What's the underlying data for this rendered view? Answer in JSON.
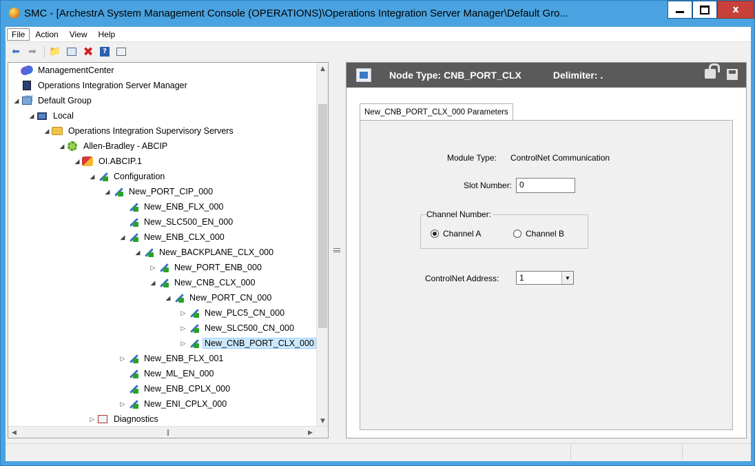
{
  "window": {
    "title": "SMC - [ArchestrA System Management Console (OPERATIONS)\\Operations Integration Server Manager\\Default Gro..."
  },
  "menubar": {
    "items": [
      "File",
      "Action",
      "View",
      "Help"
    ]
  },
  "toolbar": {
    "buttons": [
      "back-arrow-icon",
      "forward-arrow-icon",
      "up-folder-icon",
      "show-hide-tree-icon",
      "delete-icon",
      "help-icon",
      "properties-icon"
    ]
  },
  "tree": {
    "items": [
      {
        "label": "ManagementCenter",
        "icon": "management-icon",
        "level": 0,
        "expander": ""
      },
      {
        "label": "Operations Integration Server Manager",
        "icon": "server-icon",
        "level": 0,
        "expander": ""
      },
      {
        "label": "Default Group",
        "icon": "group-icon",
        "level": 0,
        "expander": "expanded"
      },
      {
        "label": "Local",
        "icon": "computer-icon",
        "level": 1,
        "expander": "expanded"
      },
      {
        "label": "Operations Integration Supervisory Servers",
        "icon": "folder-icon",
        "level": 2,
        "expander": "expanded"
      },
      {
        "label": "Allen-Bradley - ABCIP",
        "icon": "gear-icon",
        "level": 3,
        "expander": "expanded"
      },
      {
        "label": "OI.ABCIP.1",
        "icon": "oi-server-icon",
        "level": 4,
        "expander": "expanded"
      },
      {
        "label": "Configuration",
        "icon": "configuration-icon",
        "level": 5,
        "expander": "expanded"
      },
      {
        "label": "New_PORT_CIP_000",
        "icon": "port-icon",
        "level": 6,
        "expander": "expanded"
      },
      {
        "label": "New_ENB_FLX_000",
        "icon": "port-icon",
        "level": 7,
        "expander": ""
      },
      {
        "label": "New_SLC500_EN_000",
        "icon": "port-icon",
        "level": 7,
        "expander": ""
      },
      {
        "label": "New_ENB_CLX_000",
        "icon": "port-icon",
        "level": 7,
        "expander": "expanded"
      },
      {
        "label": "New_BACKPLANE_CLX_000",
        "icon": "port-icon",
        "level": 8,
        "expander": "expanded"
      },
      {
        "label": "New_PORT_ENB_000",
        "icon": "port-icon",
        "level": 9,
        "expander": "collapsed"
      },
      {
        "label": "New_CNB_CLX_000",
        "icon": "port-icon",
        "level": 9,
        "expander": "expanded"
      },
      {
        "label": "New_PORT_CN_000",
        "icon": "port-icon",
        "level": 10,
        "expander": "expanded"
      },
      {
        "label": "New_PLC5_CN_000",
        "icon": "port-icon",
        "level": 11,
        "expander": "collapsed"
      },
      {
        "label": "New_SLC500_CN_000",
        "icon": "port-icon",
        "level": 11,
        "expander": "collapsed"
      },
      {
        "label": "New_CNB_PORT_CLX_000",
        "icon": "port-icon",
        "level": 11,
        "expander": "collapsed",
        "selected": true
      },
      {
        "label": "New_ENB_FLX_001",
        "icon": "port-icon",
        "level": 7,
        "expander": "collapsed"
      },
      {
        "label": "New_ML_EN_000",
        "icon": "port-icon",
        "level": 7,
        "expander": ""
      },
      {
        "label": "New_ENB_CPLX_000",
        "icon": "port-icon",
        "level": 7,
        "expander": ""
      },
      {
        "label": "New_ENI_CPLX_000",
        "icon": "port-icon",
        "level": 7,
        "expander": "collapsed"
      },
      {
        "label": "Diagnostics",
        "icon": "diagnostics-icon",
        "level": 5,
        "expander": "collapsed"
      }
    ]
  },
  "node_header": {
    "node_type": "Node Type: CNB_PORT_CLX",
    "delimiter": "Delimiter: ."
  },
  "tab": {
    "label": "New_CNB_PORT_CLX_000 Parameters"
  },
  "form": {
    "module_type_label": "Module Type:",
    "module_type_value": "ControlNet Communication",
    "slot_number_label": "Slot Number:",
    "slot_number_value": "0",
    "channel_number_label": "Channel Number:",
    "channel_a_label": "Channel A",
    "channel_b_label": "Channel B",
    "channel_selected": "Channel A",
    "controlnet_address_label": "ControlNet Address:",
    "controlnet_address_value": "1"
  }
}
